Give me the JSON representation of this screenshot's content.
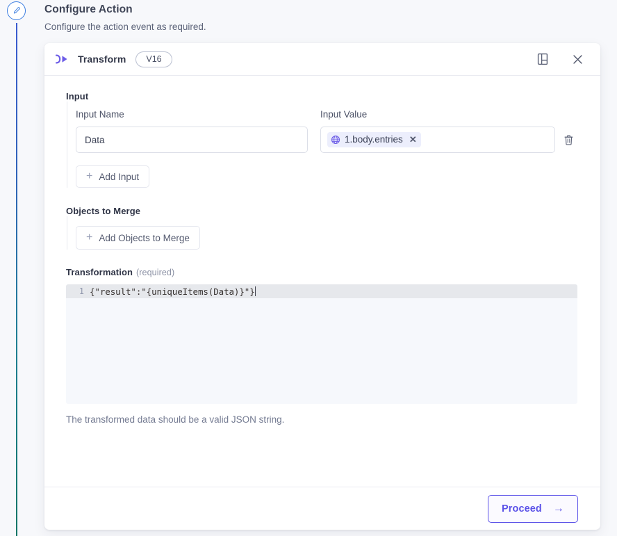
{
  "rail": {
    "node_icon": "edit-pencil-icon",
    "accent_top": "#3b5bd0",
    "accent_bottom": "#0d7566"
  },
  "page": {
    "title": "Configure Action",
    "subtitle": "Configure the action event as required."
  },
  "card_header": {
    "icon": "transform-icon",
    "title": "Transform",
    "version_badge": "V16",
    "docs_icon": "book-panel-icon",
    "close_icon": "close-icon"
  },
  "input_section": {
    "label": "Input",
    "name_label": "Input Name",
    "value_label": "Input Value",
    "name_value": "Data",
    "name_placeholder": "Input Name",
    "value_chip": {
      "icon": "globe-icon",
      "text": "1.body.entries",
      "remove_icon": "chip-remove-icon",
      "bg": "#eceefc"
    },
    "delete_icon": "trash-icon",
    "add_label": "Add Input",
    "add_icon": "plus-icon"
  },
  "merge_section": {
    "label": "Objects to Merge",
    "add_label": "Add Objects to Merge",
    "add_icon": "plus-icon"
  },
  "transformation": {
    "label": "Transformation",
    "required_hint": "(required)",
    "line_number": "1",
    "code": "{\"result\":\"{uniqueItems(Data)}\"}",
    "helper_text": "The transformed data should be a valid JSON string."
  },
  "footer": {
    "proceed_label": "Proceed",
    "proceed_arrow": "→",
    "accent": "#5b52e8"
  }
}
